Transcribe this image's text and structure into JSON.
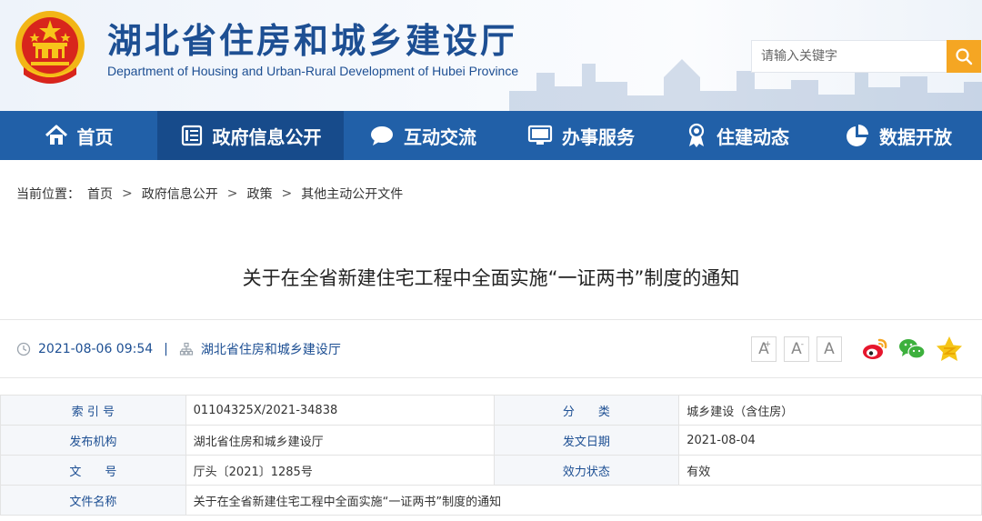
{
  "header": {
    "title": "湖北省住房和城乡建设厅",
    "subtitle": "Department of Housing and Urban-Rural Development of Hubei Province",
    "search_placeholder": "请输入关键字"
  },
  "nav": [
    {
      "label": "首页",
      "icon": "home-icon",
      "active": false
    },
    {
      "label": "政府信息公开",
      "icon": "document-list-icon",
      "active": true
    },
    {
      "label": "互动交流",
      "icon": "chat-bubble-icon",
      "active": false
    },
    {
      "label": "办事服务",
      "icon": "monitor-icon",
      "active": false
    },
    {
      "label": "住建动态",
      "icon": "award-icon",
      "active": false
    },
    {
      "label": "数据开放",
      "icon": "pie-chart-icon",
      "active": false
    }
  ],
  "breadcrumb": {
    "prefix": "当前位置：",
    "items": [
      "首页",
      "政府信息公开",
      "政策",
      "其他主动公开文件"
    ],
    "separator": ">"
  },
  "article": {
    "title": "关于在全省新建住宅工程中全面实施“一证两书”制度的通知",
    "datetime": "2021-08-06 09:54",
    "pipe": "|",
    "source": "湖北省住房和城乡建设厅"
  },
  "font_size_buttons": [
    "A",
    "A",
    "A"
  ],
  "share_icons": [
    "weibo-icon",
    "wechat-icon",
    "qzone-icon"
  ],
  "info": {
    "rows": [
      {
        "l1": "索 引 号",
        "v1": "01104325X/2021-34838",
        "l2": "分　　类",
        "v2": "城乡建设（含住房）"
      },
      {
        "l1": "发布机构",
        "v1": "湖北省住房和城乡建设厅",
        "l2": "发文日期",
        "v2": "2021-08-04"
      },
      {
        "l1": "文　　号",
        "v1": "厅头〔2021〕1285号",
        "l2": "效力状态",
        "v2": "有效"
      }
    ],
    "name_label": "文件名称",
    "name_value": "关于在全省新建住宅工程中全面实施“一证两书”制度的通知"
  },
  "colors": {
    "primary": "#1d4f93",
    "nav_bg": "#2160a8",
    "nav_active": "#174b8b",
    "search_btn": "#f5a623"
  }
}
